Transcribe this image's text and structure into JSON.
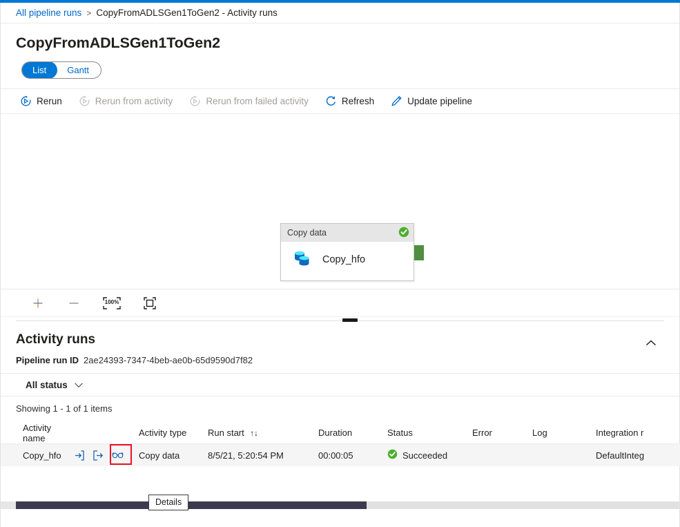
{
  "theme": {
    "accent": "#0078d4",
    "link": "#0068c9",
    "success": "#4caf2e",
    "highlight": "#e81123",
    "port": "#4f8f3f"
  },
  "breadcrumb": {
    "root_label": "All pipeline runs",
    "separator": ">",
    "current_label": "CopyFromADLSGen1ToGen2 - Activity runs"
  },
  "page": {
    "title": "CopyFromADLSGen1ToGen2"
  },
  "view_toggle": {
    "active": "List",
    "inactive": "Gantt"
  },
  "toolbar": {
    "rerun_label": "Rerun",
    "rerun_from_activity_label": "Rerun from activity",
    "rerun_from_failed_label": "Rerun from failed activity",
    "refresh_label": "Refresh",
    "update_pipeline_label": "Update pipeline"
  },
  "canvas": {
    "node": {
      "header": "Copy data",
      "name": "Copy_hfo",
      "status": "Succeeded"
    },
    "zoom_controls": {
      "zoom_in": "+",
      "zoom_out": "–",
      "zoom_level": "100%",
      "fit_label": "Fit to screen"
    }
  },
  "activity_runs": {
    "section_title": "Activity runs",
    "run_id_label": "Pipeline run ID",
    "run_id_value": "2ae24393-7347-4beb-ae0b-65d9590d7f82",
    "status_filter": "All status",
    "showing_text": "Showing 1 - 1 of 1 items",
    "columns": [
      "Activity name",
      "",
      "Activity type",
      "Run start",
      "Duration",
      "Status",
      "Error",
      "Log",
      "Integration r"
    ],
    "sort_indicator": "↑↓",
    "rows": [
      {
        "activity_name": "Copy_hfo",
        "activity_type": "Copy data",
        "run_start": "8/5/21, 5:20:54 PM",
        "duration": "00:00:05",
        "status": "Succeeded",
        "error": "",
        "log": "",
        "integration_runtime": "DefaultInteg"
      }
    ]
  },
  "tooltip": {
    "text": "Details"
  }
}
